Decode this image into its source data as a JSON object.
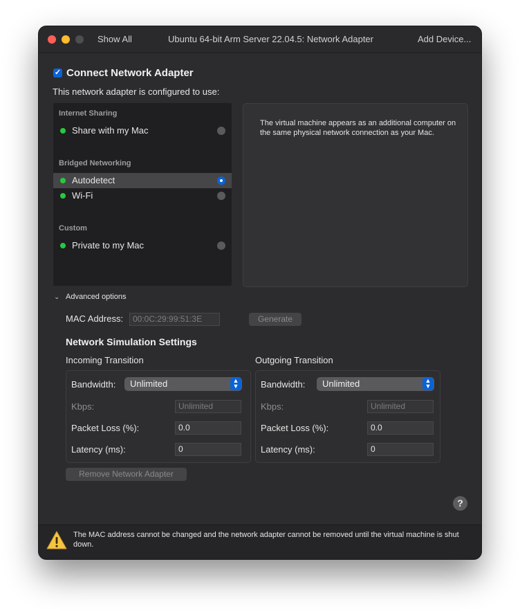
{
  "titlebar": {
    "show_all": "Show All",
    "title": "Ubuntu 64-bit Arm Server 22.04.5: Network Adapter",
    "add_device": "Add Device..."
  },
  "connect": {
    "checked": true,
    "label": "Connect Network Adapter",
    "subtitle": "This network adapter is configured to use:"
  },
  "network_list": {
    "sections": [
      {
        "header": "Internet Sharing",
        "items": [
          {
            "label": "Share with my Mac",
            "status": "green",
            "selected": false
          }
        ]
      },
      {
        "header": "Bridged Networking",
        "items": [
          {
            "label": "Autodetect",
            "status": "green",
            "selected": true
          },
          {
            "label": "Wi-Fi",
            "status": "green",
            "selected": false
          }
        ]
      },
      {
        "header": "Custom",
        "items": [
          {
            "label": "Private to my Mac",
            "status": "green",
            "selected": false
          }
        ]
      }
    ]
  },
  "description": "The virtual machine appears as an additional computer on the same physical network connection as your Mac.",
  "advanced": {
    "toggle_label": "Advanced options",
    "mac_label": "MAC Address:",
    "mac_value": "00:0C:29:99:51:3E",
    "generate_label": "Generate"
  },
  "simulation": {
    "title": "Network Simulation Settings",
    "incoming": {
      "title": "Incoming Transition",
      "bandwidth_label": "Bandwidth:",
      "bandwidth_value": "Unlimited",
      "kbps_label": "Kbps:",
      "kbps_value": "Unlimited",
      "loss_label": "Packet Loss (%):",
      "loss_value": "0.0",
      "latency_label": "Latency (ms):",
      "latency_value": "0"
    },
    "outgoing": {
      "title": "Outgoing Transition",
      "bandwidth_label": "Bandwidth:",
      "bandwidth_value": "Unlimited",
      "kbps_label": "Kbps:",
      "kbps_value": "Unlimited",
      "loss_label": "Packet Loss (%):",
      "loss_value": "0.0",
      "latency_label": "Latency (ms):",
      "latency_value": "0"
    }
  },
  "remove_label": "Remove Network Adapter",
  "help_label": "?",
  "footer": {
    "icon": "warning-icon",
    "message": "The MAC address cannot be changed and the network adapter cannot be removed until the virtual machine is shut down."
  },
  "colors": {
    "accent": "#0a63d6",
    "status_green": "#27c93f",
    "window_bg": "#2c2c2e"
  }
}
